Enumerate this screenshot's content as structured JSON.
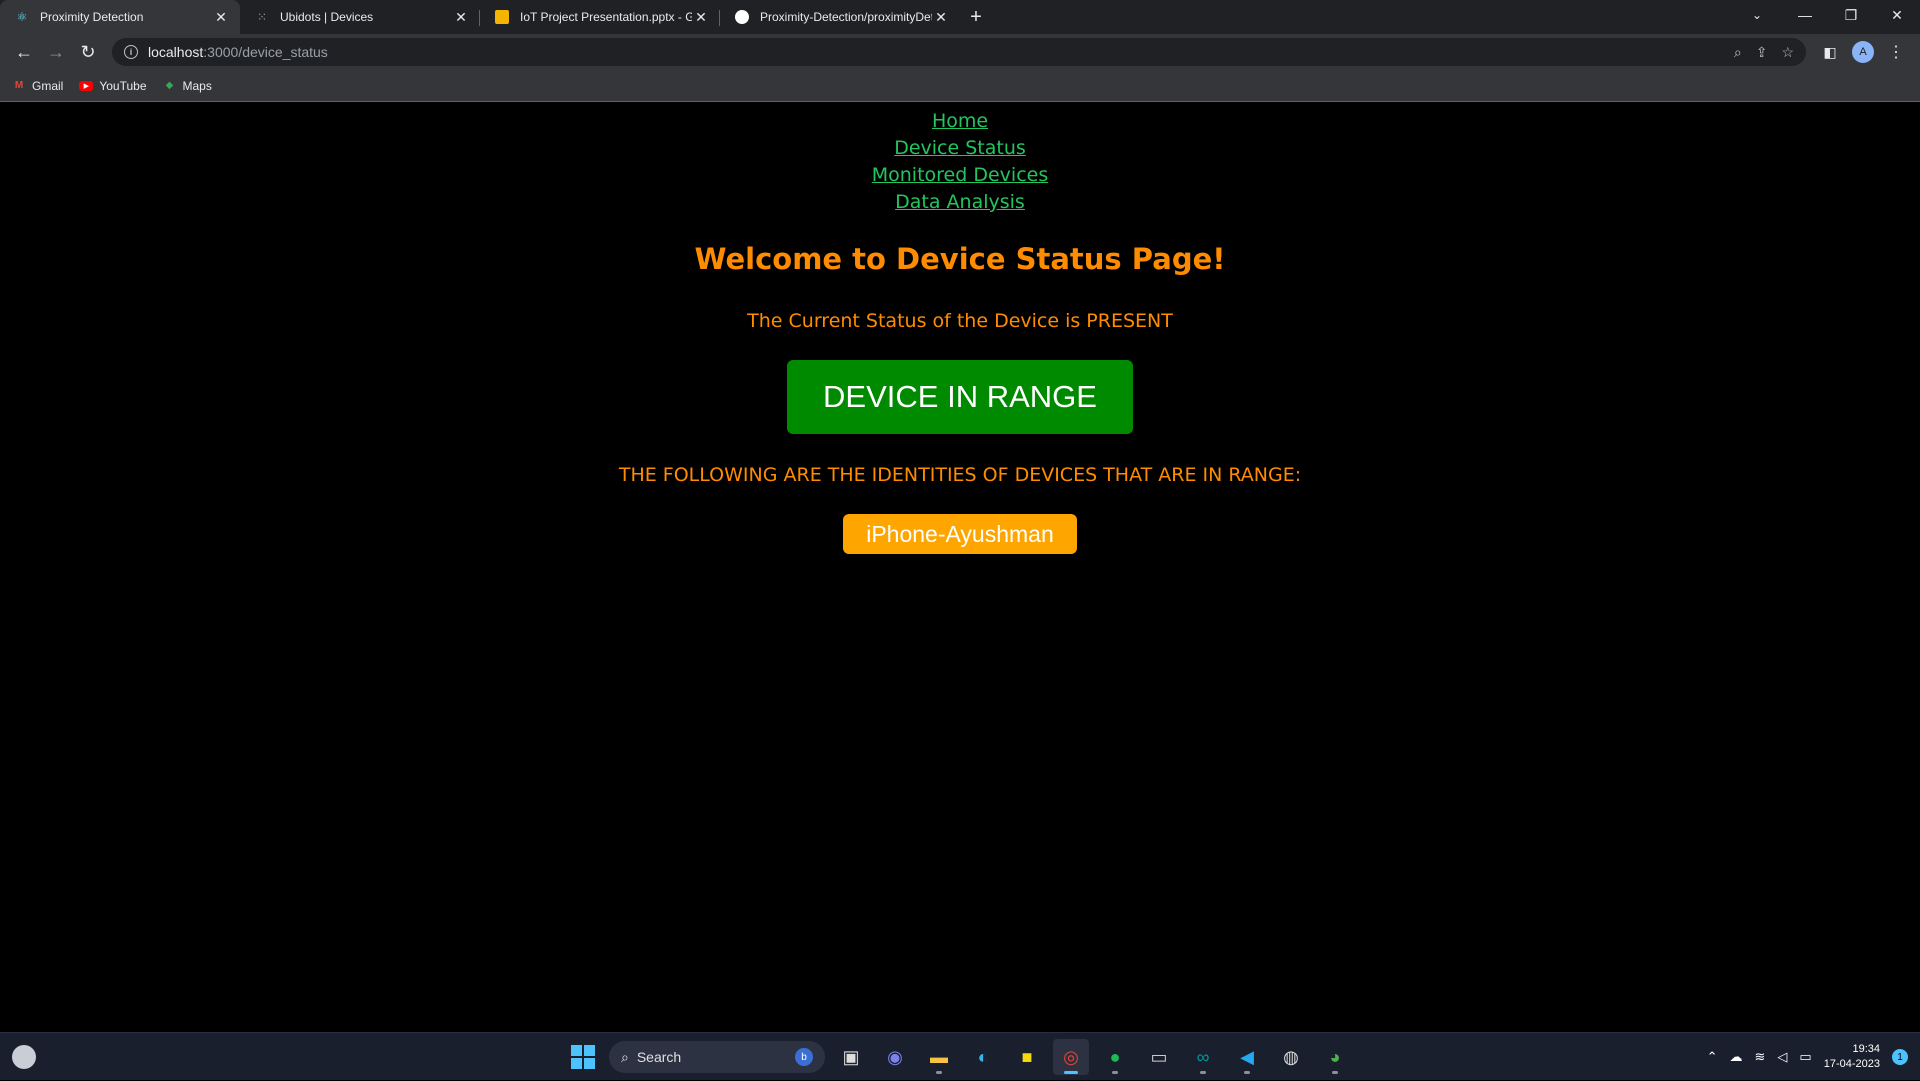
{
  "browser": {
    "tabs": [
      {
        "title": "Proximity Detection",
        "icon": "react-icon",
        "color": "#61dafb",
        "active": true
      },
      {
        "title": "Ubidots | Devices",
        "icon": "ubidots-icon",
        "color": "#9aa0a6",
        "active": false
      },
      {
        "title": "IoT Project Presentation.pptx - Google Slides",
        "icon": "slides-icon",
        "color": "#f4b400",
        "active": false
      },
      {
        "title": "Proximity-Detection/proximityDetection",
        "icon": "github-icon",
        "color": "#ffffff",
        "active": false
      }
    ],
    "url_host": "localhost",
    "url_path": ":3000/device_status",
    "profile_initial": "A",
    "bookmarks": [
      {
        "label": "Gmail",
        "icon": "gmail-icon"
      },
      {
        "label": "YouTube",
        "icon": "youtube-icon"
      },
      {
        "label": "Maps",
        "icon": "maps-icon"
      }
    ]
  },
  "page": {
    "nav": [
      "Home",
      "Device Status",
      "Monitored Devices",
      "Data Analysis"
    ],
    "heading": "Welcome to Device Status Page!",
    "status_text": "The Current Status of the Device is PRESENT",
    "range_button": "DEVICE IN RANGE",
    "identities_text": "THE FOLLOWING ARE THE IDENTITIES OF DEVICES THAT ARE IN RANGE:",
    "devices": [
      "iPhone-Ayushman"
    ],
    "colors": {
      "link": "#22c55e",
      "accent": "#ff8c00",
      "in_range": "#008a00",
      "device_chip": "#ffa500"
    }
  },
  "taskbar": {
    "search_label": "Search",
    "time": "19:34",
    "date": "17-04-2023",
    "notification_count": "1"
  }
}
